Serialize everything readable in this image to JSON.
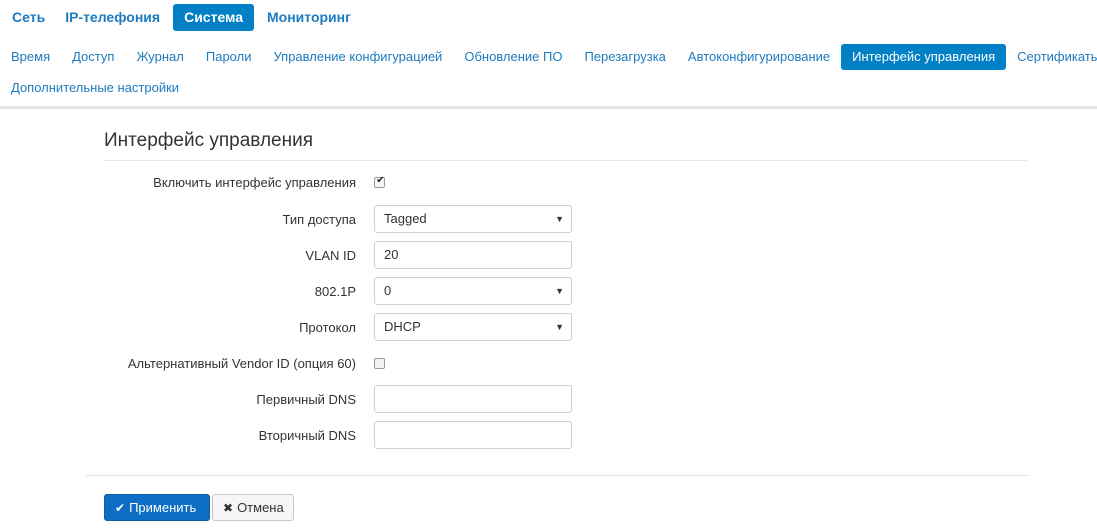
{
  "top_nav": [
    {
      "label": "Сеть"
    },
    {
      "label": "IP-телефония"
    },
    {
      "label": "Система",
      "active": true
    },
    {
      "label": "Мониторинг"
    }
  ],
  "sub_nav": {
    "row1": [
      {
        "label": "Время"
      },
      {
        "label": "Доступ"
      },
      {
        "label": "Журнал"
      },
      {
        "label": "Пароли"
      },
      {
        "label": "Управление конфигурацией"
      },
      {
        "label": "Обновление ПО"
      },
      {
        "label": "Перезагрузка"
      },
      {
        "label": "Автоконфигурирование"
      },
      {
        "label": "Интерфейс управления",
        "active": true
      },
      {
        "label": "Сертификаты"
      }
    ],
    "row2": [
      {
        "label": "Дополнительные настройки"
      }
    ]
  },
  "form": {
    "title": "Интерфейс управления",
    "enable": {
      "label": "Включить интерфейс управления",
      "checked": true
    },
    "access_type": {
      "label": "Тип доступа",
      "value": "Tagged"
    },
    "vlan_id": {
      "label": "VLAN ID",
      "value": "20"
    },
    "priority": {
      "label": "802.1P",
      "value": "0"
    },
    "protocol": {
      "label": "Протокол",
      "value": "DHCP"
    },
    "alt_vendor": {
      "label": "Альтернативный Vendor ID (опция 60)",
      "checked": false
    },
    "primary_dns": {
      "label": "Первичный DNS",
      "value": ""
    },
    "secondary_dns": {
      "label": "Вторичный DNS",
      "value": ""
    }
  },
  "buttons": {
    "apply": "Применить",
    "cancel": "Отмена"
  },
  "colors": {
    "accent": "#0280c6",
    "link": "#1e7bbf",
    "apply_bg": "#0c6ec4"
  }
}
